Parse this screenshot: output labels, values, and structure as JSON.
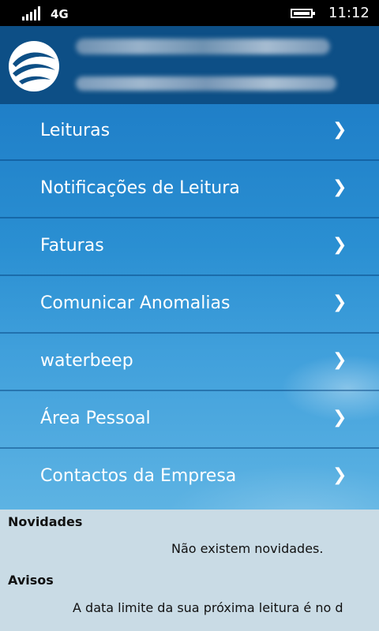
{
  "status_bar": {
    "network": "4G",
    "time": "11:12"
  },
  "menu": {
    "items": [
      {
        "label": "Leituras",
        "chevron": "❯"
      },
      {
        "label": "Notificações de Leitura",
        "chevron": "❯"
      },
      {
        "label": "Faturas",
        "chevron": "❯"
      },
      {
        "label": "Comunicar Anomalias",
        "chevron": "❯"
      },
      {
        "label": "waterbeep",
        "chevron": "❯"
      },
      {
        "label": "Área Pessoal",
        "chevron": "❯"
      },
      {
        "label": "Contactos da Empresa",
        "chevron": "❯"
      }
    ]
  },
  "news": {
    "title": "Novidades",
    "text": "Não existem novidades."
  },
  "notices": {
    "title": "Avisos",
    "text": "A data limite da sua próxima leitura é no d"
  },
  "colors": {
    "header": "#0d4f86",
    "menu_top": "#1f7fc8",
    "menu_bottom": "#5db3e3",
    "info_bg": "#c9dbe5"
  }
}
